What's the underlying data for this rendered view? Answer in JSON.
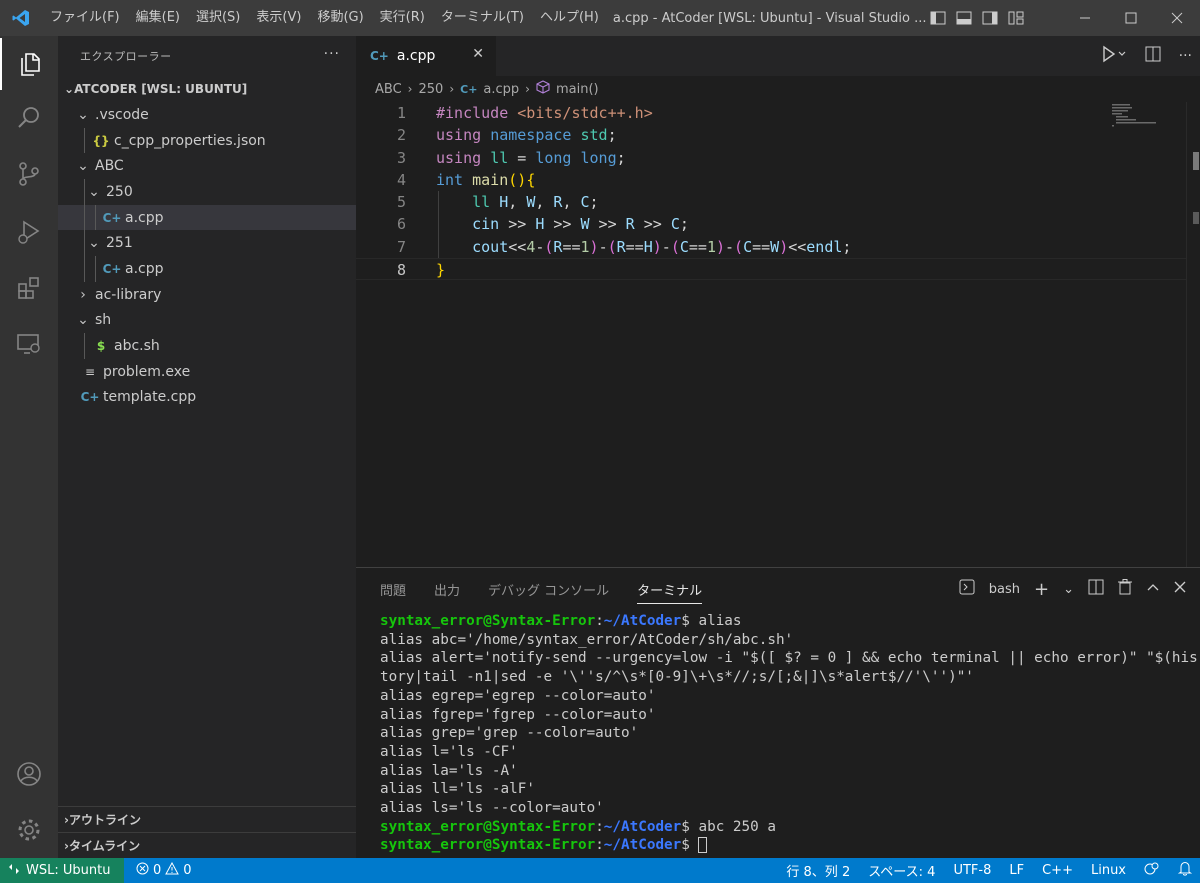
{
  "titlebar": {
    "menu": [
      "ファイル(F)",
      "編集(E)",
      "選択(S)",
      "表示(V)",
      "移動(G)",
      "実行(R)",
      "ターミナル(T)",
      "ヘルプ(H)"
    ],
    "window_title": "a.cpp - AtCoder [WSL: Ubuntu] - Visual Studio ..."
  },
  "activitybar": {
    "items": [
      "explorer-icon",
      "search-icon",
      "source-control-icon",
      "run-debug-icon",
      "extensions-icon",
      "remote-explorer-icon"
    ],
    "bottom": [
      "accounts-icon",
      "settings-gear-icon"
    ]
  },
  "sidebar": {
    "title": "エクスプローラー",
    "more": "···",
    "root": "ATCODER [WSL: UBUNTU]",
    "tree": [
      {
        "label": ".vscode",
        "icon": "chevron-down",
        "depth": 1
      },
      {
        "label": "c_cpp_properties.json",
        "icon": "json",
        "depth": 2
      },
      {
        "label": "ABC",
        "icon": "chevron-down",
        "depth": 1
      },
      {
        "label": "250",
        "icon": "chevron-down",
        "depth": 2
      },
      {
        "label": "a.cpp",
        "icon": "cpp",
        "depth": 3,
        "selected": true
      },
      {
        "label": "251",
        "icon": "chevron-down",
        "depth": 2
      },
      {
        "label": "a.cpp",
        "icon": "cpp",
        "depth": 3
      },
      {
        "label": "ac-library",
        "icon": "chevron-right",
        "depth": 1
      },
      {
        "label": "sh",
        "icon": "chevron-down",
        "depth": 1
      },
      {
        "label": "abc.sh",
        "icon": "sh",
        "depth": 2
      },
      {
        "label": "problem.exe",
        "icon": "exe",
        "depth": 1
      },
      {
        "label": "template.cpp",
        "icon": "cpp",
        "depth": 1
      }
    ],
    "outline": "アウトライン",
    "timeline": "タイムライン"
  },
  "editor": {
    "tab_label": "a.cpp",
    "tab_close": "✕",
    "breadcrumb": [
      "ABC",
      "250",
      "a.cpp",
      "main()"
    ],
    "current_line": 8,
    "lines": [
      [
        {
          "t": "#include ",
          "c": "k-pp"
        },
        {
          "t": "<bits/stdc++.h>",
          "c": "k-inc"
        }
      ],
      [
        {
          "t": "using",
          "c": "k-pp"
        },
        {
          "t": " ",
          "c": "k-op"
        },
        {
          "t": "namespace",
          "c": "k-kw"
        },
        {
          "t": " ",
          "c": "k-op"
        },
        {
          "t": "std",
          "c": "k-ty"
        },
        {
          "t": ";",
          "c": "k-op"
        }
      ],
      [
        {
          "t": "using",
          "c": "k-pp"
        },
        {
          "t": " ",
          "c": "k-op"
        },
        {
          "t": "ll",
          "c": "k-ty"
        },
        {
          "t": " = ",
          "c": "k-op"
        },
        {
          "t": "long long",
          "c": "k-kw"
        },
        {
          "t": ";",
          "c": "k-op"
        }
      ],
      [
        {
          "t": "int",
          "c": "k-kw"
        },
        {
          "t": " ",
          "c": "k-op"
        },
        {
          "t": "main",
          "c": "k-fn"
        },
        {
          "t": "()",
          "c": "k-br"
        },
        {
          "t": "{",
          "c": "k-br"
        }
      ],
      [
        {
          "t": "    ",
          "c": "k-op"
        },
        {
          "t": "ll",
          "c": "k-ty"
        },
        {
          "t": " ",
          "c": "k-op"
        },
        {
          "t": "H",
          "c": "k-var"
        },
        {
          "t": ", ",
          "c": "k-op"
        },
        {
          "t": "W",
          "c": "k-var"
        },
        {
          "t": ", ",
          "c": "k-op"
        },
        {
          "t": "R",
          "c": "k-var"
        },
        {
          "t": ", ",
          "c": "k-op"
        },
        {
          "t": "C",
          "c": "k-var"
        },
        {
          "t": ";",
          "c": "k-op"
        }
      ],
      [
        {
          "t": "    ",
          "c": "k-op"
        },
        {
          "t": "cin",
          "c": "k-var"
        },
        {
          "t": " >> ",
          "c": "k-op"
        },
        {
          "t": "H",
          "c": "k-var"
        },
        {
          "t": " >> ",
          "c": "k-op"
        },
        {
          "t": "W",
          "c": "k-var"
        },
        {
          "t": " >> ",
          "c": "k-op"
        },
        {
          "t": "R",
          "c": "k-var"
        },
        {
          "t": " >> ",
          "c": "k-op"
        },
        {
          "t": "C",
          "c": "k-var"
        },
        {
          "t": ";",
          "c": "k-op"
        }
      ],
      [
        {
          "t": "    ",
          "c": "k-op"
        },
        {
          "t": "cout",
          "c": "k-var"
        },
        {
          "t": "<<",
          "c": "k-op"
        },
        {
          "t": "4",
          "c": "k-num"
        },
        {
          "t": "-",
          "c": "k-op"
        },
        {
          "t": "(",
          "c": "k-p2"
        },
        {
          "t": "R",
          "c": "k-var"
        },
        {
          "t": "==",
          "c": "k-op"
        },
        {
          "t": "1",
          "c": "k-num"
        },
        {
          "t": ")",
          "c": "k-p2"
        },
        {
          "t": "-",
          "c": "k-op"
        },
        {
          "t": "(",
          "c": "k-p2"
        },
        {
          "t": "R",
          "c": "k-var"
        },
        {
          "t": "==",
          "c": "k-op"
        },
        {
          "t": "H",
          "c": "k-var"
        },
        {
          "t": ")",
          "c": "k-p2"
        },
        {
          "t": "-",
          "c": "k-op"
        },
        {
          "t": "(",
          "c": "k-p2"
        },
        {
          "t": "C",
          "c": "k-var"
        },
        {
          "t": "==",
          "c": "k-op"
        },
        {
          "t": "1",
          "c": "k-num"
        },
        {
          "t": ")",
          "c": "k-p2"
        },
        {
          "t": "-",
          "c": "k-op"
        },
        {
          "t": "(",
          "c": "k-p2"
        },
        {
          "t": "C",
          "c": "k-var"
        },
        {
          "t": "==",
          "c": "k-op"
        },
        {
          "t": "W",
          "c": "k-var"
        },
        {
          "t": ")",
          "c": "k-p2"
        },
        {
          "t": "<<",
          "c": "k-op"
        },
        {
          "t": "endl",
          "c": "k-var"
        },
        {
          "t": ";",
          "c": "k-op"
        }
      ],
      [
        {
          "t": "}",
          "c": "k-br"
        }
      ]
    ]
  },
  "panel": {
    "tabs": [
      "問題",
      "出力",
      "デバッグ コンソール",
      "ターミナル"
    ],
    "active_tab": "ターミナル",
    "shell": "bash",
    "terminal_lines": [
      {
        "prompt": true,
        "cmd": " alias"
      },
      {
        "text": "alias abc='/home/syntax_error/AtCoder/sh/abc.sh'"
      },
      {
        "text": "alias alert='notify-send --urgency=low -i \"$([ $? = 0 ] && echo terminal || echo error)\" \"$(his"
      },
      {
        "text": "tory|tail -n1|sed -e '\\''s/^\\s*[0-9]\\+\\s*//;s/[;&|]\\s*alert$//'\\'')\"'"
      },
      {
        "text": "alias egrep='egrep --color=auto'"
      },
      {
        "text": "alias fgrep='fgrep --color=auto'"
      },
      {
        "text": "alias grep='grep --color=auto'"
      },
      {
        "text": "alias l='ls -CF'"
      },
      {
        "text": "alias la='ls -A'"
      },
      {
        "text": "alias ll='ls -alF'"
      },
      {
        "text": "alias ls='ls --color=auto'"
      },
      {
        "prompt": true,
        "cmd": " abc 250 a"
      },
      {
        "prompt": true,
        "cmd": " ",
        "cursor": true
      }
    ],
    "prompt_user": "syntax_error@Syntax-Error",
    "prompt_path": "~/AtCoder"
  },
  "statusbar": {
    "remote": "WSL: Ubuntu",
    "errors": "0",
    "warnings": "0",
    "position": "行 8、列 2",
    "spaces": "スペース: 4",
    "encoding": "UTF-8",
    "eol": "LF",
    "language": "C++",
    "platform": "Linux"
  }
}
